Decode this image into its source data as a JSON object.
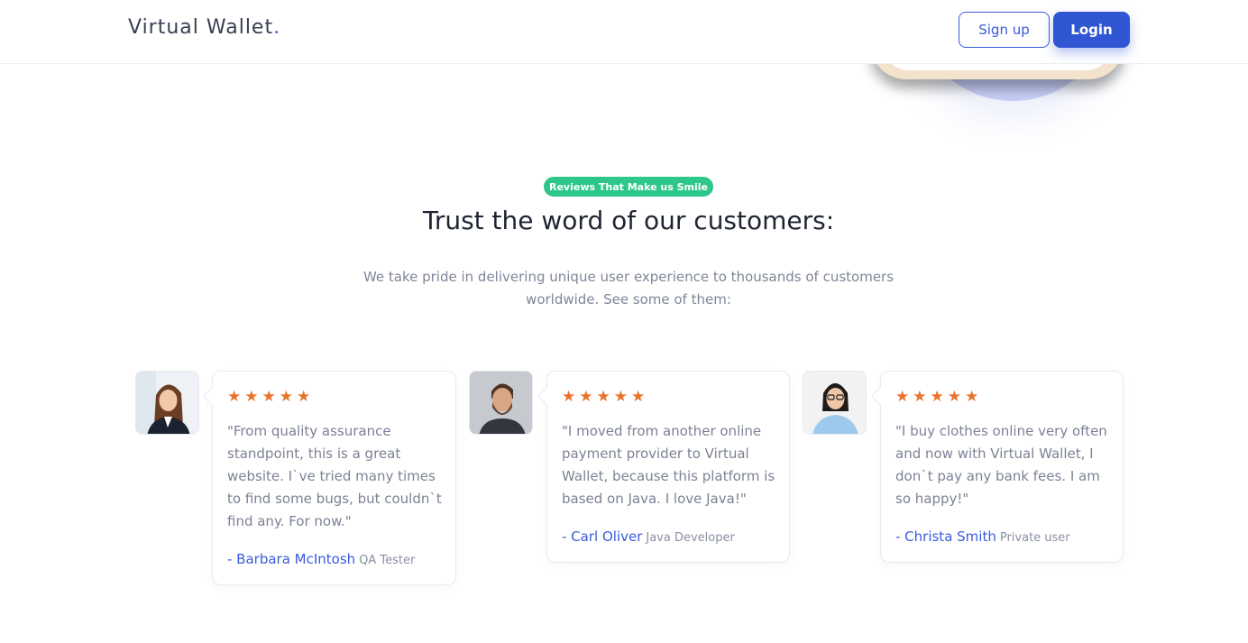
{
  "navbar": {
    "brand": "Virtual Wallet",
    "brand_dot": ".",
    "signup_label": "Sign up",
    "login_label": "Login"
  },
  "section": {
    "badge": "Reviews That Make us Smile",
    "title": "Trust the word of our customers:",
    "subtitle_line1": "We take pride in delivering unique user experience to thousands of customers",
    "subtitle_line2": "worldwide. See some of them:"
  },
  "reviews": [
    {
      "stars": "★★★★★",
      "quote": "\"From quality assurance standpoint, this is a great website. I`ve tried many times to find some bugs, but couldn`t find any. For now.\"",
      "name": "- Barbara McIntosh",
      "role": "QA Tester"
    },
    {
      "stars": "★★★★★",
      "quote": "\"I moved from another online payment provider to Virtual Wallet, because this platform is based on Java. I love Java!\"",
      "name": "- Carl Oliver",
      "role": "Java Developer"
    },
    {
      "stars": "★★★★★",
      "quote": "\"I buy clothes online very often and now with Virtual Wallet, I don`t pay any bank fees. I am so happy!\"",
      "name": "- Christa Smith",
      "role": "Private user"
    }
  ],
  "colors": {
    "accent": "#3056d3",
    "badge": "#2dc78a",
    "stars": "#e8732a"
  }
}
